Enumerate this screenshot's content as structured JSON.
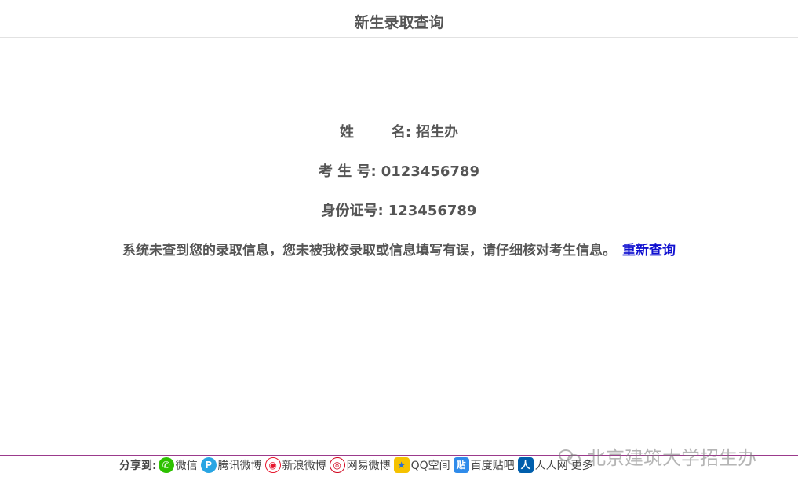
{
  "header": {
    "title": "新生录取查询"
  },
  "result": {
    "name_label_first": "姓",
    "name_label_last": "名:",
    "name_value": "招生办",
    "exam_no_label": "考 生 号:",
    "exam_no_value": "0123456789",
    "id_label": "身份证号:",
    "id_value": "123456789",
    "message": "系统未查到您的录取信息，您未被我校录取或信息填写有误，请仔细核对考生信息。",
    "requery_link": "重新查询",
    "link_color": "#1010d0"
  },
  "share": {
    "label": "分享到:",
    "items": [
      {
        "icon": "wechat-icon",
        "glyph": "✆",
        "label": "微信"
      },
      {
        "icon": "tencent-weibo-icon",
        "glyph": "P",
        "label": "腾讯微博"
      },
      {
        "icon": "sina-weibo-icon",
        "glyph": "◉",
        "label": "新浪微博"
      },
      {
        "icon": "netease-weibo-icon",
        "glyph": "◎",
        "label": "网易微博"
      },
      {
        "icon": "qzone-icon",
        "glyph": "★",
        "label": "QQ空间"
      },
      {
        "icon": "tieba-icon",
        "glyph": "贴",
        "label": "百度贴吧"
      },
      {
        "icon": "renren-icon",
        "glyph": "人",
        "label": "人人网"
      }
    ],
    "more": "更多"
  },
  "watermark": {
    "text": "北京建筑大学招生办"
  }
}
